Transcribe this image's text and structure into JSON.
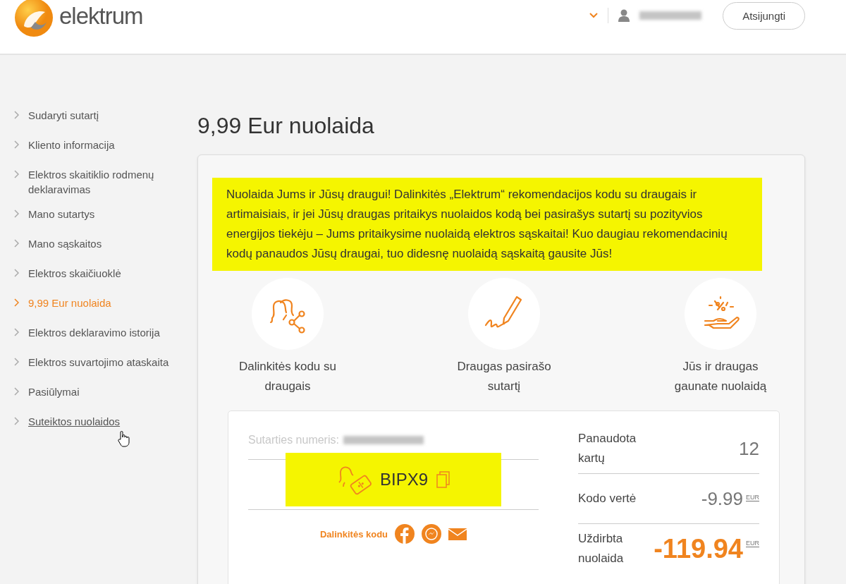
{
  "header": {
    "logo": "elektrum",
    "logout_button": "Atsijungti"
  },
  "sidebar": {
    "items": [
      {
        "label": "Sudaryti sutartį",
        "selected": false,
        "hovered": false
      },
      {
        "label": "Kliento informacija",
        "selected": false,
        "hovered": false
      },
      {
        "label": "Elektros skaitiklio rodmenų deklaravimas",
        "selected": false,
        "hovered": false
      },
      {
        "label": "Mano sutartys",
        "selected": false,
        "hovered": false
      },
      {
        "label": "Mano sąskaitos",
        "selected": false,
        "hovered": false
      },
      {
        "label": "Elektros skaičiuoklė",
        "selected": false,
        "hovered": false
      },
      {
        "label": "9,99 Eur nuolaida",
        "selected": true,
        "hovered": false
      },
      {
        "label": "Elektros deklaravimo istorija",
        "selected": false,
        "hovered": false
      },
      {
        "label": "Elektros suvartojimo ataskaita",
        "selected": false,
        "hovered": false
      },
      {
        "label": "Pasiūlymai",
        "selected": false,
        "hovered": false
      },
      {
        "label": "Suteiktos nuolaidos",
        "selected": false,
        "hovered": true
      }
    ]
  },
  "page": {
    "title": "9,99 Eur nuolaida",
    "intro": "Nuolaida Jums ir Jūsų draugui! Dalinkitės „Elektrum“ rekomendacijos kodu su draugais ir artimaisiais, ir jei Jūsų draugas pritaikys nuolaidos kodą bei pasirašys sutartį su pozityvios energijos tiekėju – Jums pritaikysime nuolaidą elektros sąskaitai! Kuo daugiau rekomendacinių kodų panaudos Jūsų draugai, tuo didesnę nuolaidą sąskaitą gausite Jūs!",
    "steps": [
      {
        "kind": "share",
        "label": "Dalinkitės kodu su draugais"
      },
      {
        "kind": "sign",
        "label": "Draugas pasirašo sutartį"
      },
      {
        "kind": "discount",
        "label": "Jūs ir draugas gaunate nuolaidą"
      }
    ],
    "code_panel": {
      "contract_label": "Sutarties numeris:",
      "code": "BIPX9",
      "share_label": "Dalinkitės kodu"
    },
    "stats": [
      {
        "kind": "count",
        "label": "Panaudota kartų",
        "value": "12"
      },
      {
        "kind": "money",
        "label": "Kodo vertė",
        "value": "-9.99",
        "unit": "EUR"
      },
      {
        "kind": "earned",
        "label": "Uždirbta nuolaida",
        "value": "-119.94",
        "unit": "EUR"
      }
    ]
  }
}
